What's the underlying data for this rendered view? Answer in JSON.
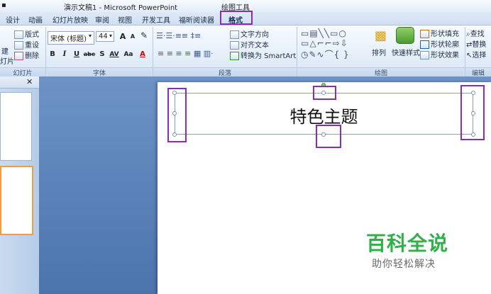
{
  "window": {
    "document_title": "演示文稿1 - Microsoft PowerPoint",
    "context_tool": "绘图工具"
  },
  "tabs": [
    {
      "label": "设计"
    },
    {
      "label": "动画"
    },
    {
      "label": "幻灯片放映"
    },
    {
      "label": "审阅"
    },
    {
      "label": "视图"
    },
    {
      "label": "开发工具"
    },
    {
      "label": "福昕阅读器"
    },
    {
      "label": "格式"
    }
  ],
  "ribbon": {
    "slides_group": {
      "layout": "版式",
      "reset": "重设",
      "delete": "删除",
      "new_slide_partial": "建",
      "new_slide_partial2": "灯片",
      "label": "幻灯片"
    },
    "font_group": {
      "font_name": "宋体 (标题)",
      "font_size": "44",
      "grow": "A",
      "shrink": "A",
      "bold": "B",
      "italic": "I",
      "underline": "U",
      "strike": "abe",
      "shadow": "S",
      "spacing": "AV",
      "case": "Aa",
      "color": "A",
      "label": "字体"
    },
    "paragraph_group": {
      "text_direction": "文字方向",
      "align_text": "对齐文本",
      "smartart": "转换为 SmartArt",
      "label": "段落"
    },
    "drawing_group": {
      "arrange": "排列",
      "quick_styles": "快速样式",
      "shape_fill": "形状填充",
      "shape_outline": "形状轮廓",
      "shape_effects": "形状效果",
      "label": "绘图"
    },
    "editing_group": {
      "find": "查找",
      "replace": "替换",
      "select": "选择",
      "label": "编辑"
    }
  },
  "panel": {
    "close": "✕"
  },
  "slide": {
    "title_text": "特色主题"
  },
  "watermark": {
    "line1": "百科全说",
    "line2": "助你轻松解决"
  },
  "colors": {
    "highlight": "#8a2db5",
    "watermark_green": "#2fb04a"
  }
}
